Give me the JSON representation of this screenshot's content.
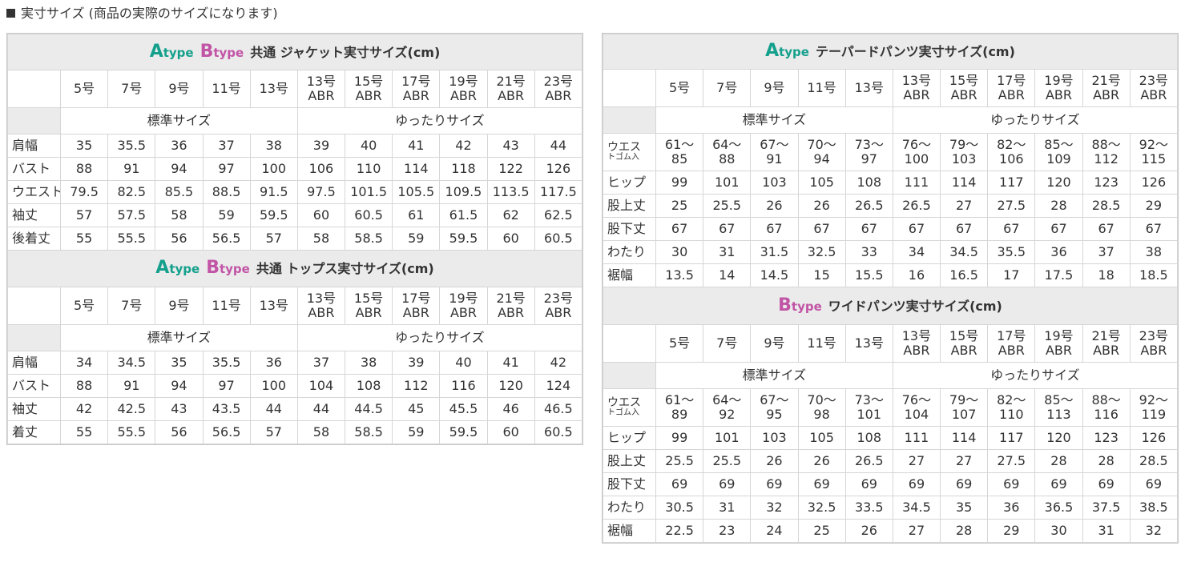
{
  "heading": "実寸サイズ (商品の実際のサイズになります)",
  "common": {
    "sizes": [
      "5号",
      "7号",
      "9号",
      "11号",
      "13号",
      "13号 ABR",
      "15号 ABR",
      "17号 ABR",
      "19号 ABR",
      "21号 ABR",
      "23号 ABR"
    ],
    "standard": "標準サイズ",
    "relaxed": "ゆったりサイズ"
  },
  "jacket": {
    "typeA": "Atype",
    "typeB": "Btype",
    "title": "共通 ジャケット実寸サイズ(cm)",
    "rows": [
      {
        "label": "肩幅",
        "values": [
          "35",
          "35.5",
          "36",
          "37",
          "38",
          "39",
          "40",
          "41",
          "42",
          "43",
          "44"
        ]
      },
      {
        "label": "バスト",
        "values": [
          "88",
          "91",
          "94",
          "97",
          "100",
          "106",
          "110",
          "114",
          "118",
          "122",
          "126"
        ]
      },
      {
        "label": "ウエスト",
        "small": true,
        "values": [
          "79.5",
          "82.5",
          "85.5",
          "88.5",
          "91.5",
          "97.5",
          "101.5",
          "105.5",
          "109.5",
          "113.5",
          "117.5"
        ]
      },
      {
        "label": "袖丈",
        "values": [
          "57",
          "57.5",
          "58",
          "59",
          "59.5",
          "60",
          "60.5",
          "61",
          "61.5",
          "62",
          "62.5"
        ]
      },
      {
        "label": "後着丈",
        "values": [
          "55",
          "55.5",
          "56",
          "56.5",
          "57",
          "58",
          "58.5",
          "59",
          "59.5",
          "60",
          "60.5"
        ]
      }
    ]
  },
  "tops": {
    "typeA": "Atype",
    "typeB": "Btype",
    "title": "共通 トップス実寸サイズ(cm)",
    "rows": [
      {
        "label": "肩幅",
        "values": [
          "34",
          "34.5",
          "35",
          "35.5",
          "36",
          "37",
          "38",
          "39",
          "40",
          "41",
          "42"
        ]
      },
      {
        "label": "バスト",
        "values": [
          "88",
          "91",
          "94",
          "97",
          "100",
          "104",
          "108",
          "112",
          "116",
          "120",
          "124"
        ]
      },
      {
        "label": "袖丈",
        "values": [
          "42",
          "42.5",
          "43",
          "43.5",
          "44",
          "44",
          "44.5",
          "45",
          "45.5",
          "46",
          "46.5"
        ]
      },
      {
        "label": "着丈",
        "values": [
          "55",
          "55.5",
          "56",
          "56.5",
          "57",
          "58",
          "58.5",
          "59",
          "59.5",
          "60",
          "60.5"
        ]
      }
    ]
  },
  "tapered": {
    "typeA": "Atype",
    "title": "テーパードパンツ実寸サイズ(cm)",
    "waist_label": "ウエス",
    "waist_sub": "トゴム入",
    "waist": [
      "61～ 85",
      "64～ 88",
      "67～ 91",
      "70～ 94",
      "73～ 97",
      "76～ 100",
      "79～ 103",
      "82～ 106",
      "85～ 109",
      "88～ 112",
      "92～ 115"
    ],
    "rows": [
      {
        "label": "ヒップ",
        "values": [
          "99",
          "101",
          "103",
          "105",
          "108",
          "111",
          "114",
          "117",
          "120",
          "123",
          "126"
        ]
      },
      {
        "label": "股上丈",
        "values": [
          "25",
          "25.5",
          "26",
          "26",
          "26.5",
          "26.5",
          "27",
          "27.5",
          "28",
          "28.5",
          "29"
        ]
      },
      {
        "label": "股下丈",
        "values": [
          "67",
          "67",
          "67",
          "67",
          "67",
          "67",
          "67",
          "67",
          "67",
          "67",
          "67"
        ]
      },
      {
        "label": "わたり",
        "values": [
          "30",
          "31",
          "31.5",
          "32.5",
          "33",
          "34",
          "34.5",
          "35.5",
          "36",
          "37",
          "38"
        ]
      },
      {
        "label": "裾幅",
        "values": [
          "13.5",
          "14",
          "14.5",
          "15",
          "15.5",
          "16",
          "16.5",
          "17",
          "17.5",
          "18",
          "18.5"
        ]
      }
    ]
  },
  "wide": {
    "typeB": "Btype",
    "title": "ワイドパンツ実寸サイズ(cm)",
    "waist_label": "ウエス",
    "waist_sub": "トゴム入",
    "waist": [
      "61～ 89",
      "64～ 92",
      "67～ 95",
      "70～ 98",
      "73～ 101",
      "76～ 104",
      "79～ 107",
      "82～ 110",
      "85～ 113",
      "88～ 116",
      "92～ 119"
    ],
    "rows": [
      {
        "label": "ヒップ",
        "values": [
          "99",
          "101",
          "103",
          "105",
          "108",
          "111",
          "114",
          "117",
          "120",
          "123",
          "126"
        ]
      },
      {
        "label": "股上丈",
        "values": [
          "25.5",
          "25.5",
          "26",
          "26",
          "26.5",
          "27",
          "27",
          "27.5",
          "28",
          "28",
          "28.5"
        ]
      },
      {
        "label": "股下丈",
        "values": [
          "69",
          "69",
          "69",
          "69",
          "69",
          "69",
          "69",
          "69",
          "69",
          "69",
          "69"
        ]
      },
      {
        "label": "わたり",
        "values": [
          "30.5",
          "31",
          "32",
          "32.5",
          "33.5",
          "34.5",
          "35",
          "36",
          "36.5",
          "37.5",
          "38.5"
        ]
      },
      {
        "label": "裾幅",
        "values": [
          "22.5",
          "23",
          "24",
          "25",
          "26",
          "27",
          "28",
          "29",
          "30",
          "31",
          "32"
        ]
      }
    ]
  },
  "colors": {
    "typeA": "#14a08c",
    "typeB": "#c254a6",
    "header_bg": "#ebebeb",
    "border": "#d6d6d6"
  }
}
